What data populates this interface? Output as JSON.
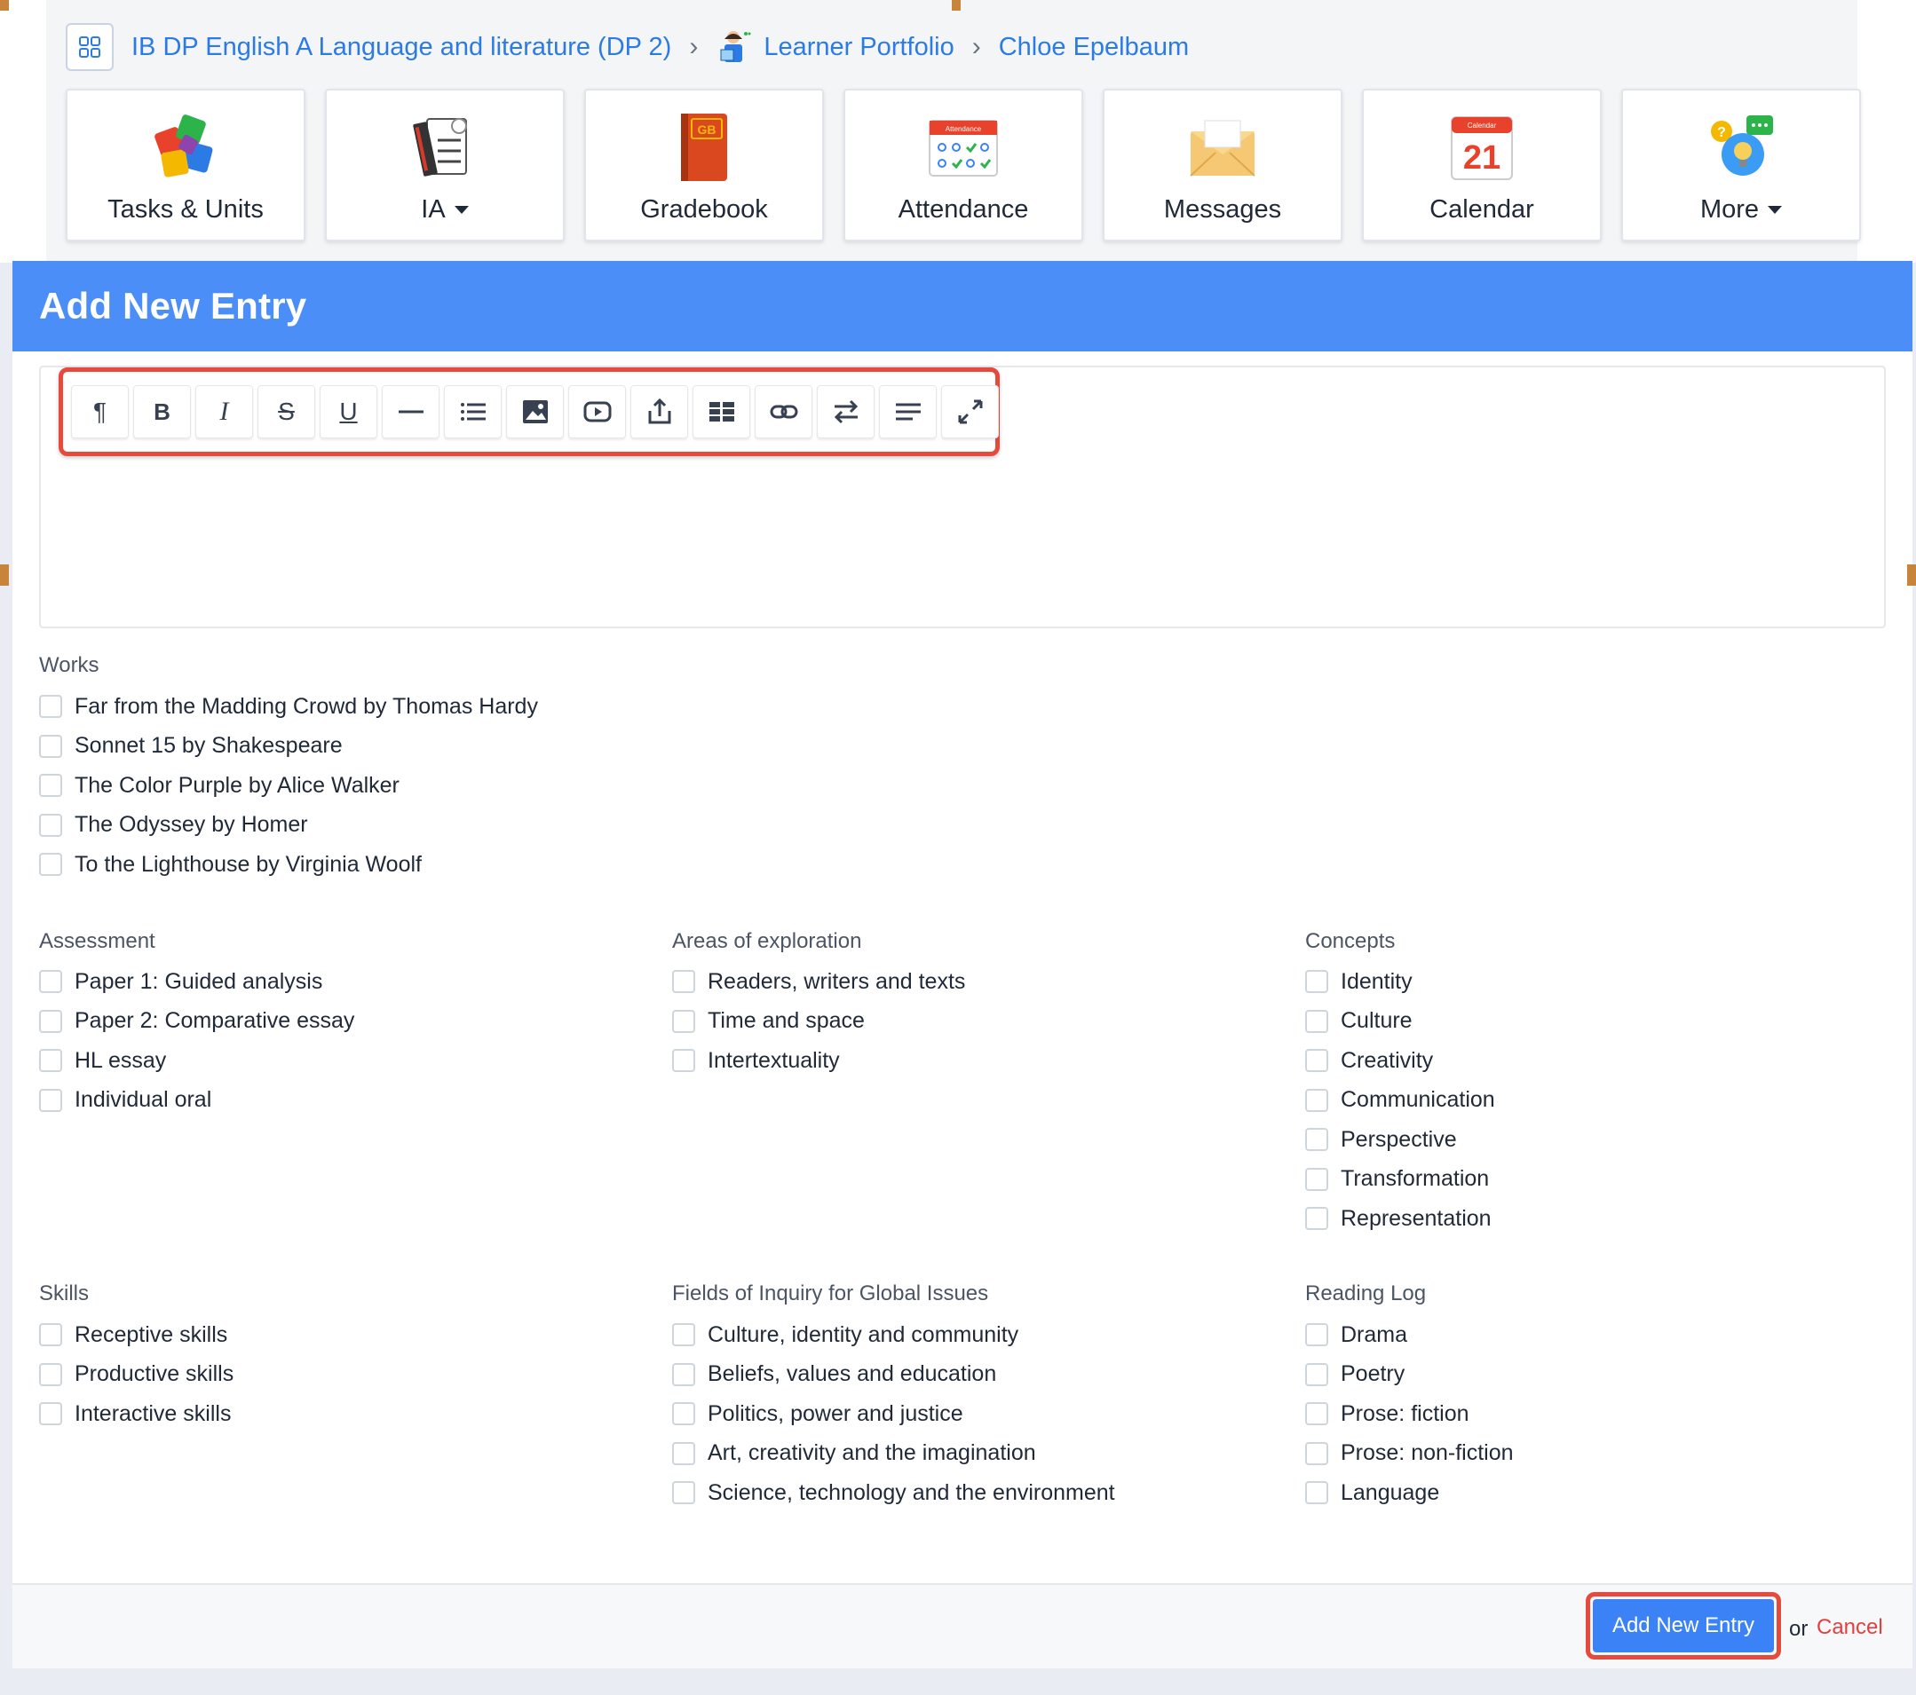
{
  "breadcrumb": {
    "course": "IB DP English A Language and literature (DP 2)",
    "portfolio": "Learner Portfolio",
    "student": "Chloe Epelbaum"
  },
  "tiles": [
    {
      "label": "Tasks & Units",
      "icon": "puzzle-icon"
    },
    {
      "label": "IA",
      "icon": "ia-checklist-icon",
      "dropdown": true
    },
    {
      "label": "Gradebook",
      "icon": "gradebook-icon",
      "badge": "GB"
    },
    {
      "label": "Attendance",
      "icon": "attendance-icon",
      "badge": "Attendance"
    },
    {
      "label": "Messages",
      "icon": "envelope-icon"
    },
    {
      "label": "Calendar",
      "icon": "calendar-icon",
      "badge": "Calendar",
      "day": "21"
    },
    {
      "label": "More",
      "icon": "more-icon",
      "dropdown": true
    }
  ],
  "panel": {
    "title": "Add New Entry"
  },
  "toolbar": [
    "paragraph-icon",
    "bold-icon",
    "italic-icon",
    "strikethrough-icon",
    "underline-icon",
    "horizontal-rule-icon",
    "list-icon",
    "image-icon",
    "video-icon",
    "upload-icon",
    "table-icon",
    "link-icon",
    "direction-icon",
    "align-icon",
    "fullscreen-icon"
  ],
  "toolbar_text": {
    "paragraph": "¶",
    "bold": "B",
    "italic": "I",
    "strike": "S",
    "underline": "U"
  },
  "works": {
    "title": "Works",
    "items": [
      "Far from the Madding Crowd by Thomas Hardy",
      "Sonnet 15 by Shakespeare",
      "The Color Purple by Alice Walker",
      "The Odyssey by Homer",
      "To the Lighthouse by Virginia Woolf"
    ]
  },
  "assessment": {
    "title": "Assessment",
    "items": [
      "Paper 1: Guided analysis",
      "Paper 2: Comparative essay",
      "HL essay",
      "Individual oral"
    ]
  },
  "areas": {
    "title": "Areas of exploration",
    "items": [
      "Readers, writers and texts",
      "Time and space",
      "Intertextuality"
    ]
  },
  "concepts": {
    "title": "Concepts",
    "items": [
      "Identity",
      "Culture",
      "Creativity",
      "Communication",
      "Perspective",
      "Transformation",
      "Representation"
    ]
  },
  "skills": {
    "title": "Skills",
    "items": [
      "Receptive skills",
      "Productive skills",
      "Interactive skills"
    ]
  },
  "fields": {
    "title": "Fields of Inquiry for Global Issues",
    "items": [
      "Culture, identity and community",
      "Beliefs, values and education",
      "Politics, power and justice",
      "Art, creativity and the imagination",
      "Science, technology and the environment"
    ]
  },
  "reading_log": {
    "title": "Reading Log",
    "items": [
      "Drama",
      "Poetry",
      "Prose: fiction",
      "Prose: non-fiction",
      "Language"
    ]
  },
  "footer": {
    "submit_label": "Add New Entry",
    "or_text": "or",
    "cancel_label": "Cancel"
  },
  "colors": {
    "accent": "#4b8ef7",
    "link": "#2c7be5",
    "highlight": "#e64a3c",
    "cancel": "#e53e3e"
  }
}
